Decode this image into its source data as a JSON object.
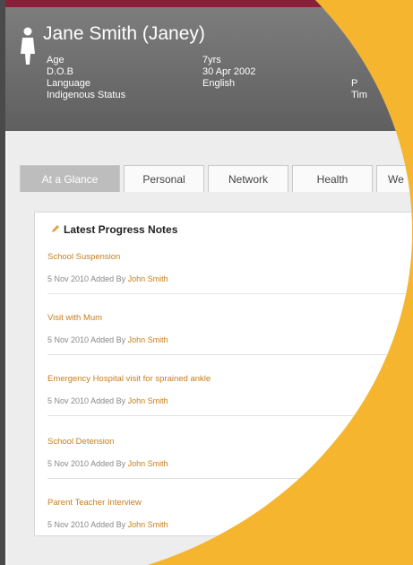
{
  "profile": {
    "name": "Jane Smith (Janey)",
    "fields": [
      {
        "label": "Age",
        "value": "7yrs"
      },
      {
        "label": "D.O.B",
        "value": "30  Apr 2002"
      },
      {
        "label": "Language",
        "value": "English"
      },
      {
        "label": "Indigenous Status",
        "value": ""
      }
    ],
    "truncated_labels": [
      "P",
      "Tim"
    ]
  },
  "tabs": [
    {
      "label": "At a Glance",
      "active": true
    },
    {
      "label": "Personal",
      "active": false
    },
    {
      "label": "Network",
      "active": false
    },
    {
      "label": "Health",
      "active": false
    },
    {
      "label": "We",
      "active": false
    }
  ],
  "panel": {
    "title": "Latest Progress Notes",
    "added_by_text": "Added By",
    "notes": [
      {
        "title": "School Suspension",
        "date": "5 Nov 2010",
        "author": "John Smith"
      },
      {
        "title": "Visit with Mum",
        "date": "5 Nov 2010",
        "author": "John Smith"
      },
      {
        "title": "Emergency Hospital visit for sprained ankle",
        "date": "5 Nov 2010",
        "author": "John Smith"
      },
      {
        "title": "School Detension",
        "date": "5 Nov 2010",
        "author": "John Smith"
      },
      {
        "title": "Parent Teacher Interview",
        "date": "5 Nov 2010",
        "author": "John Smith"
      }
    ]
  },
  "colors": {
    "accent": "#c77e1a",
    "background": "#f5b52e",
    "header": "#6b6b6b"
  }
}
